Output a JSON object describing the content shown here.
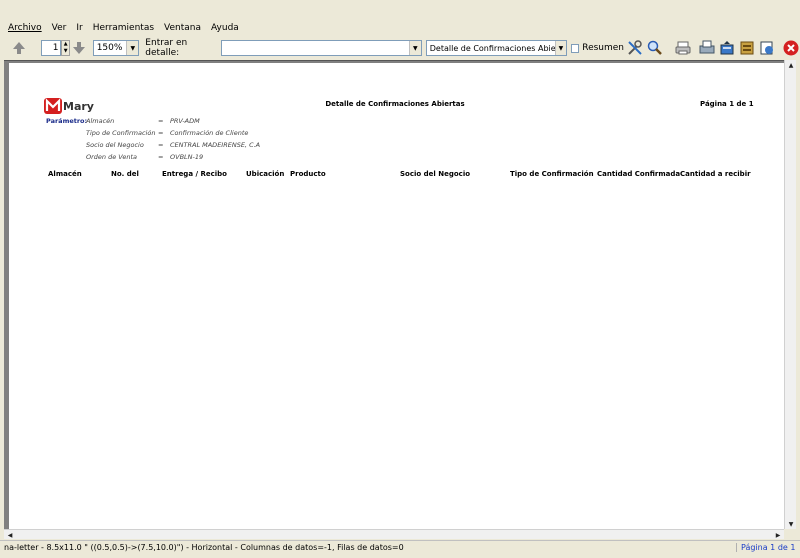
{
  "menu": {
    "items": [
      "Archivo",
      "Ver",
      "Ir",
      "Herramientas",
      "Ventana",
      "Ayuda"
    ]
  },
  "toolbar": {
    "page_value": "1",
    "zoom_value": "150%",
    "detail_label": "Entrar en detalle:",
    "detail_value": "",
    "report_value": "Detalle de Confirmaciones Abiertas",
    "summary_label": "Resumen",
    "summary_checked": false
  },
  "report": {
    "logo_text": "Mary",
    "title": "Detalle de Confirmaciones Abiertas",
    "page_label": "Página 1 de 1",
    "param_label": "Parámetro:",
    "params": [
      {
        "name": "Almacén",
        "eq": "=",
        "value": "PRV-ADM"
      },
      {
        "name": "Tipo de Confirmación",
        "eq": "=",
        "value": "Confirmación de Cliente"
      },
      {
        "name": "Socio del Negocio",
        "eq": "=",
        "value": "CENTRAL MADEIRENSE, C.A"
      },
      {
        "name": "Orden de Venta",
        "eq": "=",
        "value": "OVBLN-19"
      }
    ],
    "columns": [
      "Almacén",
      "No. del",
      "Entrega / Recibo",
      "Ubicación",
      "Producto",
      "Socio del Negocio",
      "Tipo de Confirmación",
      "Cantidad Confirmada",
      "Cantidad a recibir"
    ]
  },
  "status": {
    "text": "na-letter - 8.5x11.0 \" ((0.5,0.5)->(7.5,10.0)\") - Horizontal - Columnas de datos=-1, Filas de datos=0",
    "page": "Página 1 de 1"
  },
  "colors": {
    "accent_red": "#d42020",
    "close_red": "#d42020",
    "param_blue": "#1a2b8a",
    "status_page_blue": "#1a3cc8"
  }
}
